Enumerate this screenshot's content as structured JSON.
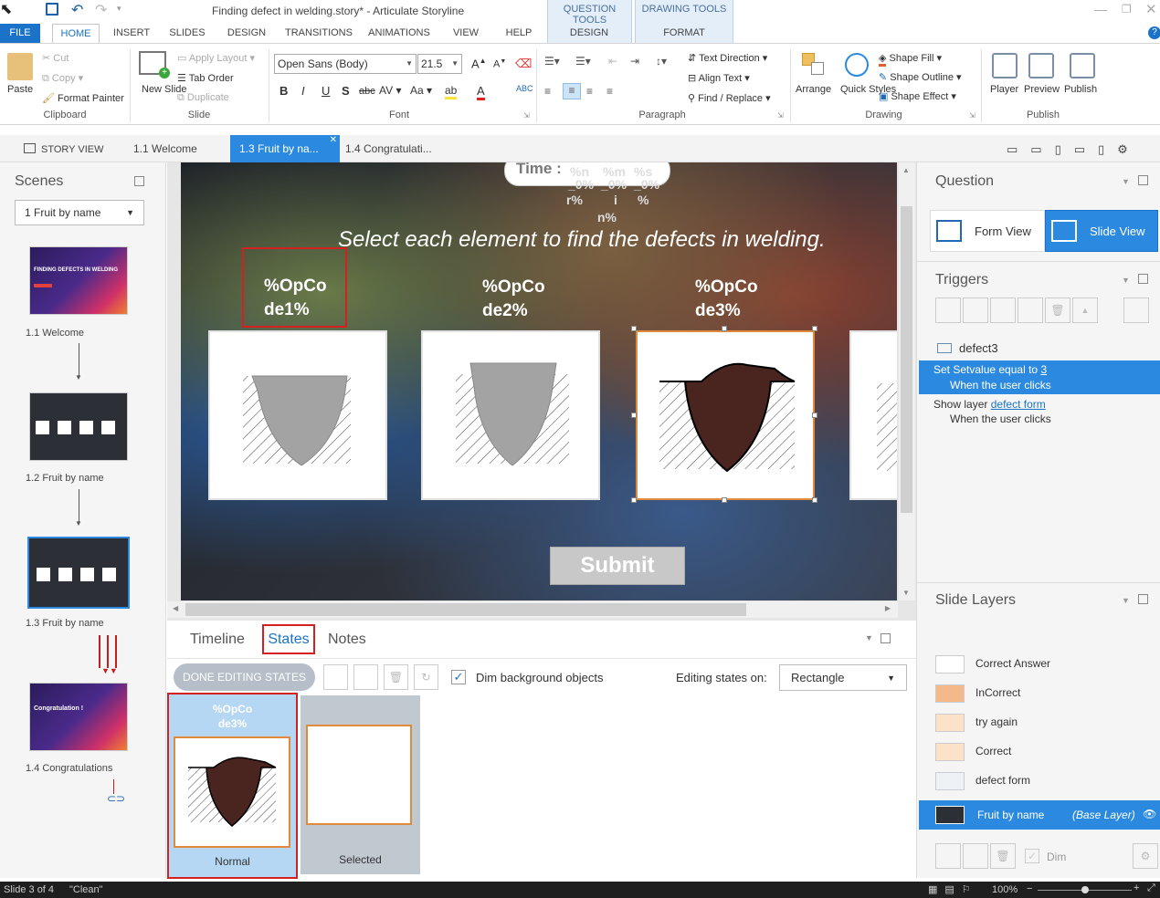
{
  "window": {
    "title": "Finding defect in welding.story* - Articulate Storyline"
  },
  "context_tabs": [
    {
      "group": "QUESTION TOOLS",
      "tab": "DESIGN"
    },
    {
      "group": "DRAWING TOOLS",
      "tab": "FORMAT"
    }
  ],
  "ribbon_tabs": [
    "FILE",
    "HOME",
    "INSERT",
    "SLIDES",
    "DESIGN",
    "TRANSITIONS",
    "ANIMATIONS",
    "VIEW",
    "HELP"
  ],
  "clipboard": {
    "paste": "Paste",
    "cut": "Cut",
    "copy": "Copy",
    "format_painter": "Format Painter",
    "group": "Clipboard"
  },
  "slide_group": {
    "new_slide": "New Slide",
    "apply_layout": "Apply Layout",
    "tab_order": "Tab Order",
    "duplicate": "Duplicate",
    "group": "Slide"
  },
  "font": {
    "family": "Open Sans (Body)",
    "size": "21.5",
    "group": "Font"
  },
  "paragraph": {
    "text_direction": "Text Direction",
    "align_text": "Align Text",
    "find_replace": "Find / Replace",
    "group": "Paragraph"
  },
  "drawing": {
    "arrange": "Arrange",
    "quick_styles": "Quick Styles",
    "shape_fill": "Shape Fill",
    "shape_outline": "Shape Outline",
    "shape_effect": "Shape Effect",
    "group": "Drawing"
  },
  "publish": {
    "player": "Player",
    "preview": "Preview",
    "publish": "Publish",
    "group": "Publish"
  },
  "view_tabs": [
    {
      "label": "STORY VIEW"
    },
    {
      "label": "1.1 Welcome"
    },
    {
      "label": "1.3 Fruit by na..."
    },
    {
      "label": "1.4 Congratulati..."
    }
  ],
  "scenes": {
    "title": "Scenes",
    "selected": "1 Fruit by name",
    "slides": [
      {
        "label": "1.1 Welcome",
        "thumb_title": "FINDING DEFECTS IN WELDING"
      },
      {
        "label": "1.2 Fruit by name"
      },
      {
        "label": "1.3 Fruit by name"
      },
      {
        "label": "1.4 Congratulations",
        "thumb_title": "Congratulation !"
      }
    ]
  },
  "slide": {
    "timer_label": "Time :",
    "timer_vars": [
      "%n",
      "_0%",
      "r%",
      "%m",
      "_0%",
      "i",
      "n%",
      "%s",
      "_0%",
      "%"
    ],
    "instruction": "Select each element to find the defects in welding.",
    "defects": [
      {
        "label_line1": "%OpCo",
        "label_line2": "de1%"
      },
      {
        "label_line1": "%OpCo",
        "label_line2": "de2%"
      },
      {
        "label_line1": "%OpCo",
        "label_line2": "de3%"
      }
    ],
    "submit": "Submit",
    "colors": {
      "grey_bead": "#a3a3a3",
      "brown_bead": "#4a2520",
      "accent": "#e08a3c"
    }
  },
  "bottom_tabs": [
    "Timeline",
    "States",
    "Notes"
  ],
  "states_toolbar": {
    "done": "DONE EDITING STATES",
    "dim": "Dim background objects",
    "dim_checked": true,
    "editing_on_label": "Editing states on:",
    "editing_on_value": "Rectangle"
  },
  "states": [
    {
      "name": "Normal",
      "label_line1": "%OpCo",
      "label_line2": "de3%"
    },
    {
      "name": "Selected"
    }
  ],
  "question_panel": {
    "title": "Question",
    "form_view": "Form View",
    "slide_view": "Slide View"
  },
  "triggers": {
    "title": "Triggers",
    "object": "defect3",
    "items": [
      {
        "action": "Set Setvalue equal to",
        "value": "3",
        "when": "When the user clicks"
      },
      {
        "action": "Show layer",
        "value": "defect form",
        "when": "When the user clicks"
      }
    ]
  },
  "layers": {
    "title": "Slide Layers",
    "items": [
      "Correct Answer",
      "InCorrect",
      "try again",
      "Correct",
      "defect form"
    ],
    "base": {
      "name": "Fruit by name",
      "tag": "(Base Layer)"
    },
    "dim": "Dim"
  },
  "status": {
    "slide": "Slide 3 of 4",
    "theme": "\"Clean\"",
    "zoom": "100%"
  }
}
